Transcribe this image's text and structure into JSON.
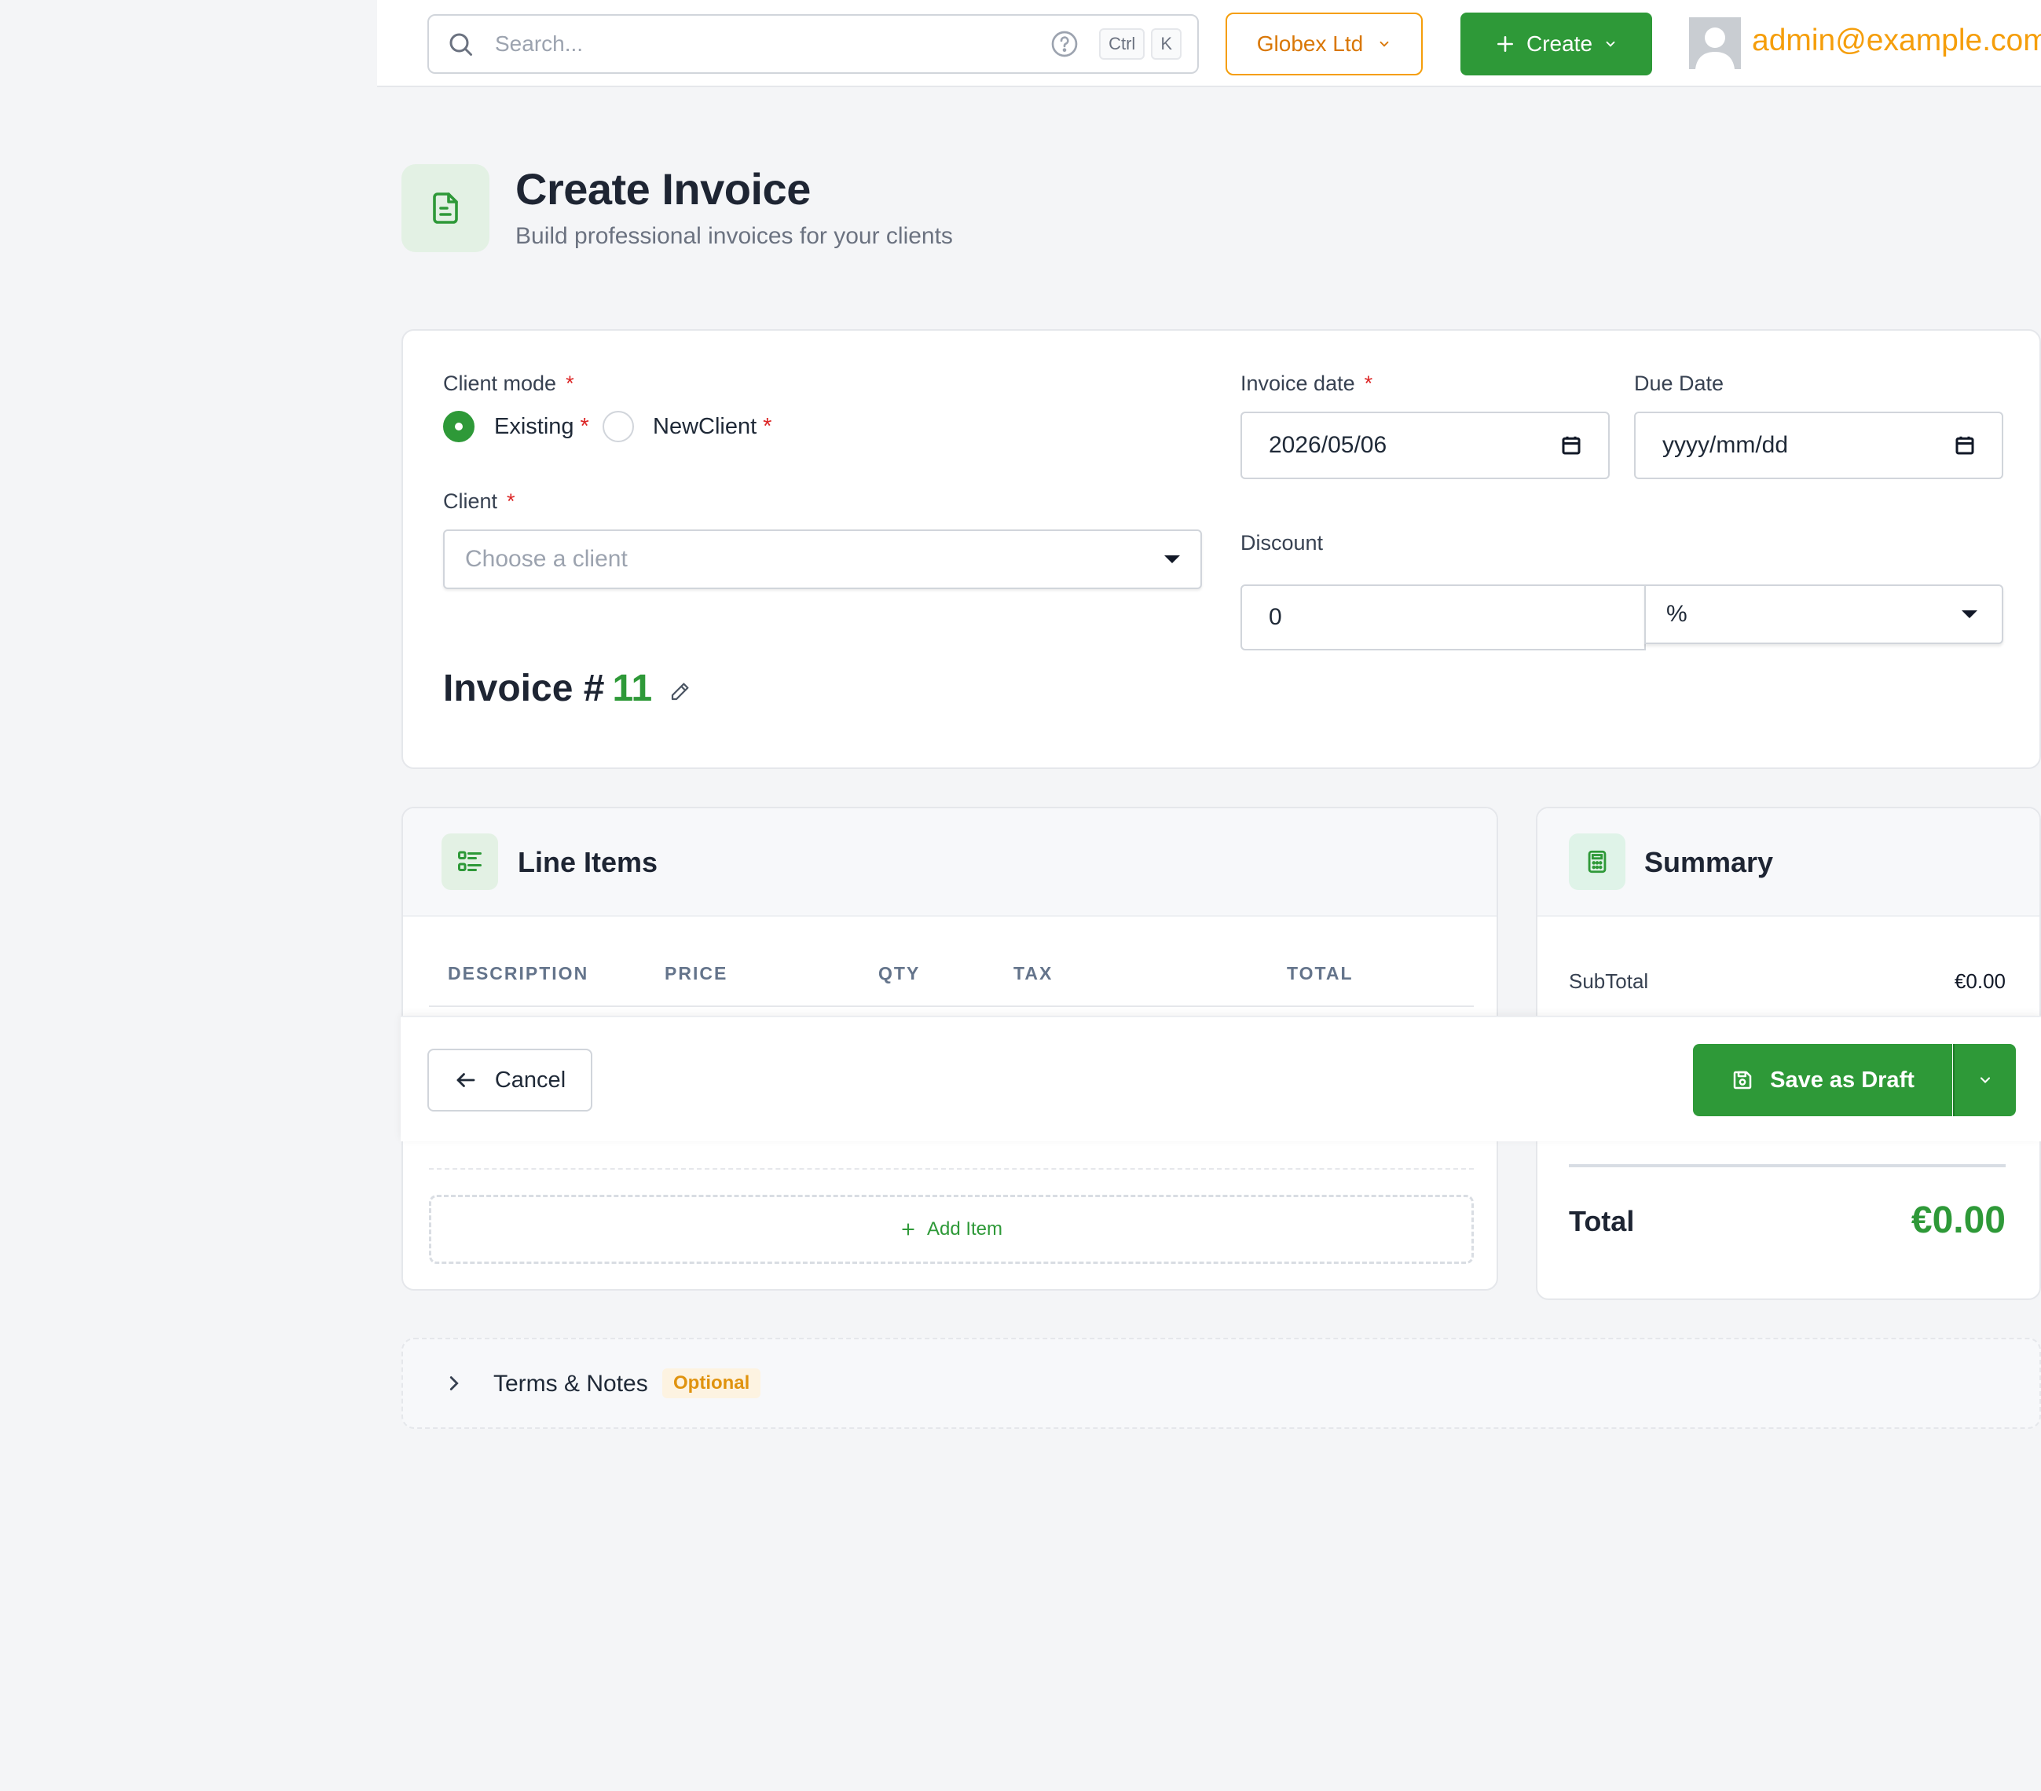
{
  "topbar": {
    "search_placeholder": "Search...",
    "kbd_ctrl": "Ctrl",
    "kbd_k": "K",
    "org_name": "Globex Ltd",
    "create_label": "Create",
    "user_email": "admin@example.com"
  },
  "header": {
    "title": "Create Invoice",
    "subtitle": "Build professional invoices for your clients"
  },
  "form": {
    "client_mode_label": "Client mode",
    "required_mark": "*",
    "mode_existing": "Existing",
    "mode_new": "NewClient",
    "selected_mode": "Existing",
    "client_label": "Client",
    "client_placeholder": "Choose a client",
    "invoice_date_label": "Invoice date",
    "invoice_date_value": "2026/05/06",
    "due_date_label": "Due Date",
    "due_date_placeholder": "yyyy/mm/dd",
    "discount_label": "Discount",
    "discount_value": "0",
    "discount_type": "%",
    "invoice_prefix": "Invoice #",
    "invoice_number": "11"
  },
  "line_items": {
    "title": "Line Items",
    "columns": [
      "DESCRIPTION",
      "PRICE",
      "QTY",
      "TAX",
      "TOTAL"
    ],
    "add_item_label": "Add Item"
  },
  "summary": {
    "title": "Summary",
    "subtotal_label": "SubTotal",
    "subtotal_value": "€0.00",
    "total_label": "Total",
    "total_value": "€0.00"
  },
  "actions": {
    "cancel_label": "Cancel",
    "save_draft_label": "Save as Draft"
  },
  "terms": {
    "title": "Terms & Notes",
    "badge": "Optional"
  },
  "colors": {
    "brand_green": "#2e9938",
    "accent_orange": "#f59e0b",
    "required_red": "#dc2626"
  },
  "icons": [
    "search-icon",
    "help-icon",
    "chevron-down-icon",
    "plus-icon",
    "user-avatar-icon",
    "document-icon",
    "calendar-icon",
    "pencil-icon",
    "list-icon",
    "calculator-icon",
    "arrow-left-icon",
    "save-icon",
    "chevron-right-icon"
  ]
}
